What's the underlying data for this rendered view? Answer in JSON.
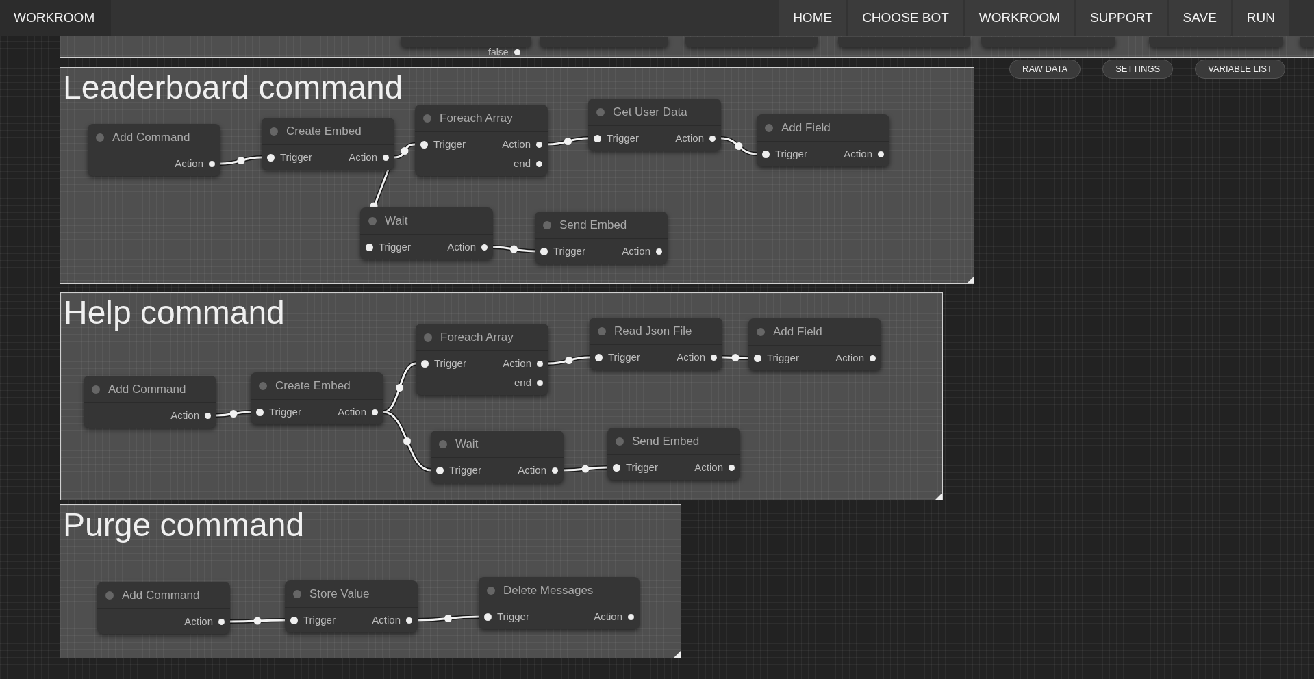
{
  "navbar": {
    "brand": "WORKROOM",
    "links": [
      {
        "label": "HOME"
      },
      {
        "label": "CHOOSE BOT"
      },
      {
        "label": "WORKROOM"
      },
      {
        "label": "SUPPORT"
      },
      {
        "label": "SAVE"
      },
      {
        "label": "RUN"
      }
    ]
  },
  "toolbar": [
    "RAW DATA",
    "SETTINGS",
    "VARIABLE LIST"
  ],
  "top_group": {
    "slot_label": "false"
  },
  "groups": [
    {
      "title": "Leaderboard command",
      "nodes": [
        {
          "title": "Add Command",
          "outputs": [
            "Action"
          ]
        },
        {
          "title": "Create Embed",
          "inputs": [
            "Trigger"
          ],
          "outputs": [
            "Action"
          ]
        },
        {
          "title": "Foreach Array",
          "inputs": [
            "Trigger"
          ],
          "outputs": [
            "Action",
            "end"
          ]
        },
        {
          "title": "Get User Data",
          "inputs": [
            "Trigger"
          ],
          "outputs": [
            "Action"
          ]
        },
        {
          "title": "Add Field",
          "inputs": [
            "Trigger"
          ],
          "outputs": [
            "Action"
          ]
        },
        {
          "title": "Wait",
          "inputs": [
            "Trigger"
          ],
          "outputs": [
            "Action"
          ]
        },
        {
          "title": "Send Embed",
          "inputs": [
            "Trigger"
          ],
          "outputs": [
            "Action"
          ]
        }
      ]
    },
    {
      "title": "Help command",
      "nodes": [
        {
          "title": "Add Command",
          "outputs": [
            "Action"
          ]
        },
        {
          "title": "Create Embed",
          "inputs": [
            "Trigger"
          ],
          "outputs": [
            "Action"
          ]
        },
        {
          "title": "Foreach Array",
          "inputs": [
            "Trigger"
          ],
          "outputs": [
            "Action",
            "end"
          ]
        },
        {
          "title": "Read Json File",
          "inputs": [
            "Trigger"
          ],
          "outputs": [
            "Action"
          ]
        },
        {
          "title": "Add Field",
          "inputs": [
            "Trigger"
          ],
          "outputs": [
            "Action"
          ]
        },
        {
          "title": "Wait",
          "inputs": [
            "Trigger"
          ],
          "outputs": [
            "Action"
          ]
        },
        {
          "title": "Send Embed",
          "inputs": [
            "Trigger"
          ],
          "outputs": [
            "Action"
          ]
        }
      ]
    },
    {
      "title": "Purge command",
      "nodes": [
        {
          "title": "Add Command",
          "outputs": [
            "Action"
          ]
        },
        {
          "title": "Store Value",
          "inputs": [
            "Trigger"
          ],
          "outputs": [
            "Action"
          ]
        },
        {
          "title": "Delete Messages",
          "inputs": [
            "Trigger"
          ],
          "outputs": [
            "Action"
          ]
        }
      ]
    }
  ]
}
